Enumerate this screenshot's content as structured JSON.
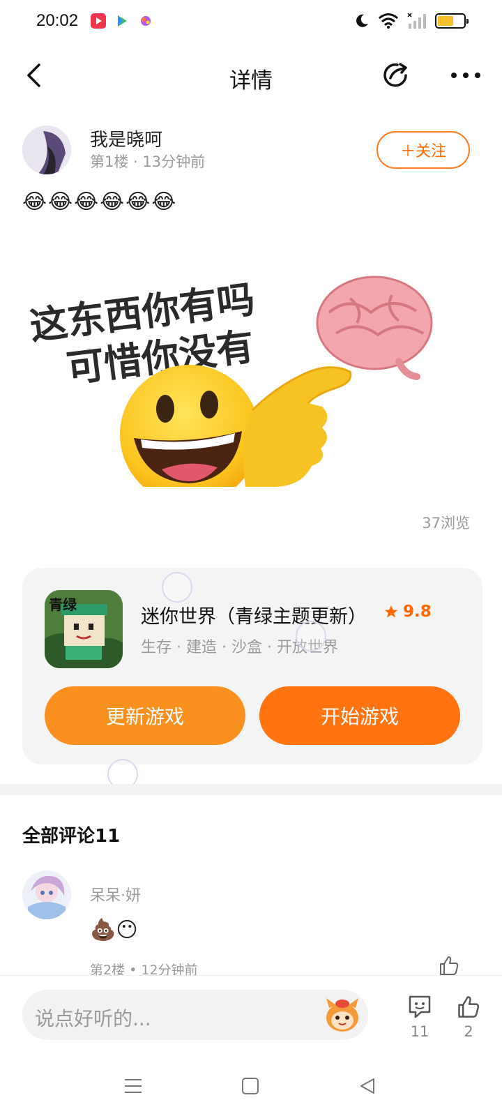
{
  "status": {
    "time": "20:02",
    "battery_level": 0.6
  },
  "header": {
    "title": "详情"
  },
  "post": {
    "author_name": "我是晓呵",
    "meta": "第1楼 · 13分钟前",
    "follow_label": "＋关注",
    "text": "😂😂😂😂😂😂",
    "meme_line1": "这东西你有吗",
    "meme_line2": "可惜你没有",
    "views": "37浏览"
  },
  "game": {
    "name": "迷你世界（青绿主题更新）",
    "rating": "9.8",
    "tags": "生存 · 建造 · 沙盒 · 开放世界",
    "icon_text": "青绿",
    "update_label": "更新游戏",
    "start_label": "开始游戏"
  },
  "comments": {
    "title": "全部评论11",
    "items": [
      {
        "name": "呆呆·妍",
        "text": "💩😶",
        "meta": "第2楼 • 12分钟前"
      }
    ]
  },
  "bottom_bar": {
    "placeholder": "说点好听的...",
    "comment_count": "11",
    "like_count": "2"
  },
  "colors": {
    "accent": "#ff6a00",
    "update_button": "#fa9020",
    "start_button": "#ff7410"
  }
}
